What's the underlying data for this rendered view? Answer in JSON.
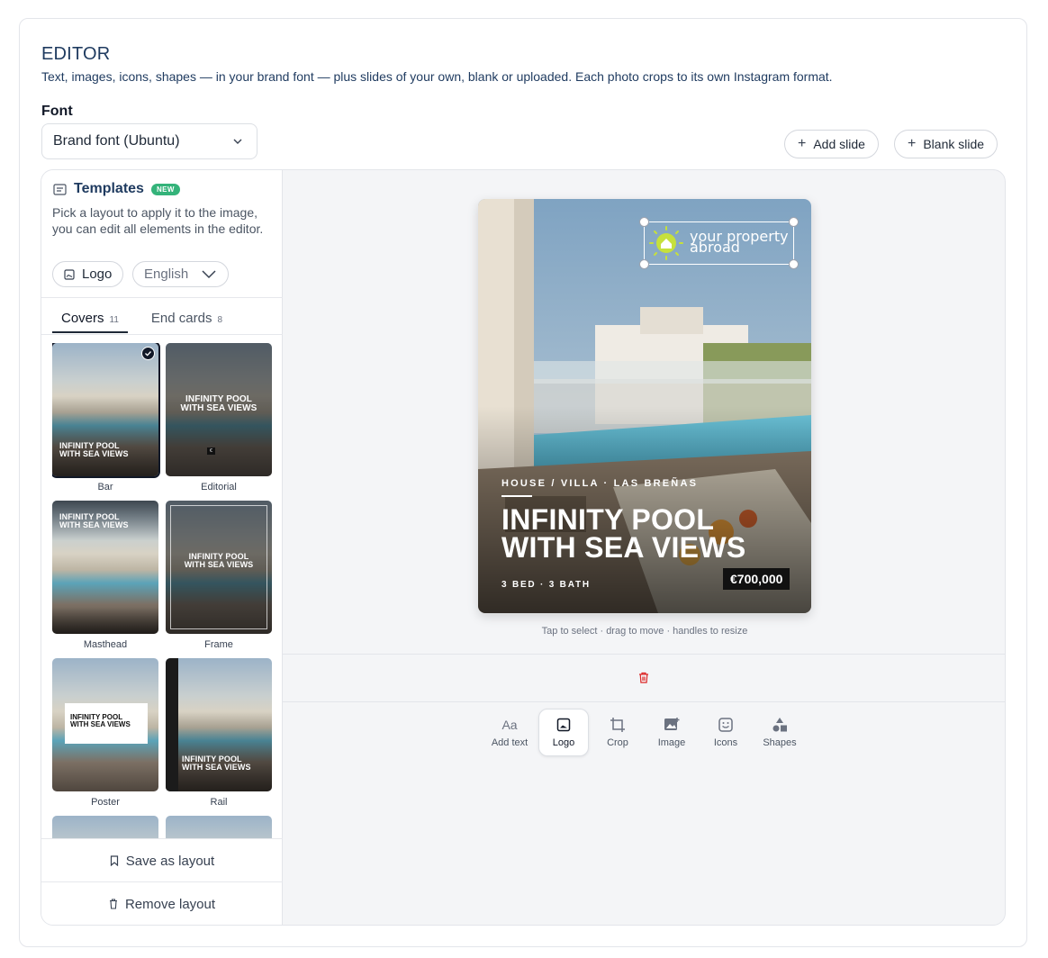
{
  "header": {
    "title": "EDITOR",
    "subtitle": "Text, images, icons, shapes — in your brand font — plus slides of your own, blank or uploaded. Each photo crops to its own Instagram format."
  },
  "font": {
    "label": "Font",
    "value": "Brand font (Ubuntu)"
  },
  "slide_actions": {
    "add": "Add slide",
    "blank": "Blank slide"
  },
  "templates": {
    "title": "Templates",
    "badge": "NEW",
    "description": "Pick a layout to apply it to the image, you can edit all elements in the editor.",
    "logo_chip": "Logo",
    "language": "English",
    "tabs": [
      {
        "label": "Covers",
        "count": "11"
      },
      {
        "label": "End cards",
        "count": "8"
      }
    ],
    "thumbs": [
      {
        "label": "Bar",
        "selected": true
      },
      {
        "label": "Editorial",
        "selected": false
      },
      {
        "label": "Masthead",
        "selected": false
      },
      {
        "label": "Frame",
        "selected": false
      },
      {
        "label": "Poster",
        "selected": false
      },
      {
        "label": "Rail",
        "selected": false
      }
    ],
    "thumb_title_line1": "INFINITY POOL",
    "thumb_title_line2": "WITH SEA VIEWS",
    "save_layout": "Save as layout",
    "remove_layout": "Remove layout"
  },
  "preview": {
    "logo_line1": "your property",
    "logo_line2": "abroad",
    "meta": "HOUSE / VILLA  ·  LAS BREÑAS",
    "title_line1": "INFINITY POOL",
    "title_line2": "WITH SEA VIEWS",
    "beds": "3 BED  ·  3 BATH",
    "price": "€700,000",
    "hint": "Tap to select · drag to move · handles to resize"
  },
  "toolbar": [
    {
      "label": "Add text",
      "icon": "text-icon"
    },
    {
      "label": "Logo",
      "icon": "logo-image-icon",
      "active": true
    },
    {
      "label": "Crop",
      "icon": "crop-icon"
    },
    {
      "label": "Image",
      "icon": "add-image-icon"
    },
    {
      "label": "Icons",
      "icon": "sticker-icon"
    },
    {
      "label": "Shapes",
      "icon": "shapes-icon"
    }
  ],
  "colors": {
    "accent": "#1e3a5f",
    "badge": "#34b37a",
    "delete": "#dc2626",
    "logo": "#c6e03c"
  }
}
